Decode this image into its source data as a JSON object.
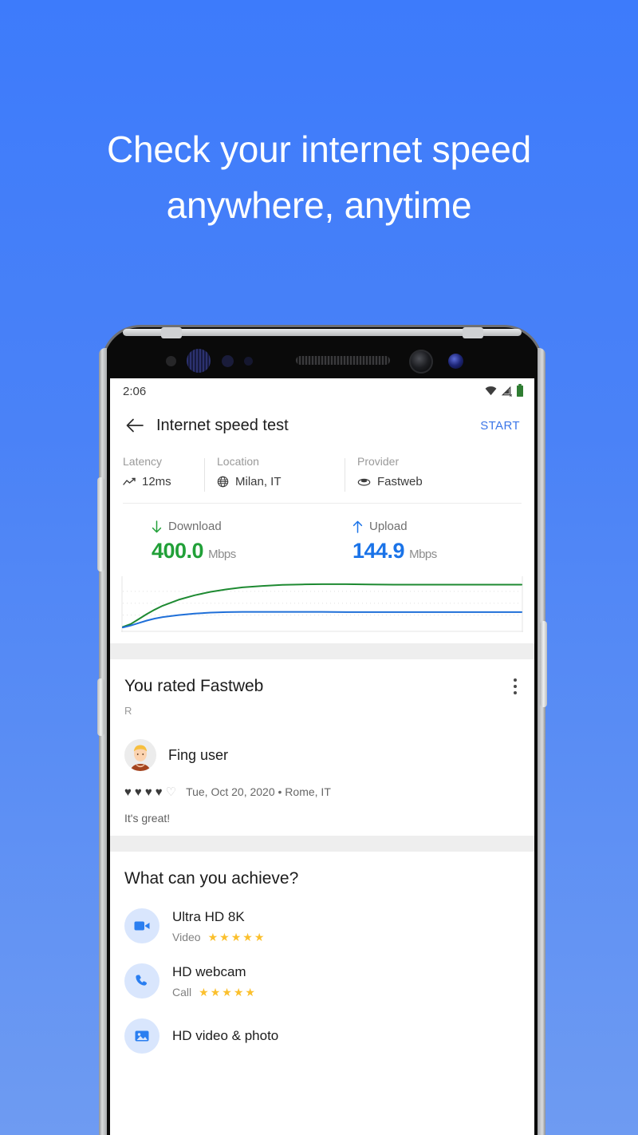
{
  "headline": {
    "line1": "Check your internet speed",
    "line2": "anywhere, anytime"
  },
  "statusbar": {
    "time": "2:06",
    "wifi_icon": "wifi-icon",
    "signal_icon": "signal-off-icon",
    "battery_icon": "battery-icon"
  },
  "appbar": {
    "back_icon": "back-arrow-icon",
    "title": "Internet speed test",
    "action": "START"
  },
  "info": [
    {
      "label": "Latency",
      "value": "12ms",
      "icon": "latency-graph-icon"
    },
    {
      "label": "Location",
      "value": "Milan, IT",
      "icon": "globe-icon"
    },
    {
      "label": "Provider",
      "value": "Fastweb",
      "icon": "router-icon"
    }
  ],
  "speeds": {
    "download": {
      "label": "Download",
      "value": "400.0",
      "unit": "Mbps",
      "color": "#21a038",
      "icon": "arrow-down-icon"
    },
    "upload": {
      "label": "Upload",
      "value": "144.9",
      "unit": "Mbps",
      "color": "#1a73e8",
      "icon": "arrow-up-icon"
    }
  },
  "chart_data": {
    "type": "line",
    "title": "",
    "xlabel": "",
    "ylabel": "",
    "xlim": [
      0,
      100
    ],
    "ylim": [
      0,
      100
    ],
    "grid": true,
    "legend_position": "none",
    "series": [
      {
        "name": "Download",
        "color": "#1e8a32",
        "x": [
          0,
          2,
          4,
          6,
          8,
          10,
          14,
          18,
          22,
          26,
          30,
          35,
          40,
          45,
          50,
          56,
          62,
          68,
          74,
          80,
          86,
          92,
          100
        ],
        "values": [
          4,
          10,
          20,
          30,
          39,
          47,
          59,
          68,
          75,
          80,
          84,
          87,
          89,
          90,
          90.5,
          90.5,
          90,
          89.5,
          89.5,
          89.5,
          89.5,
          89.5,
          89.5
        ]
      },
      {
        "name": "Upload",
        "color": "#1f6fd8",
        "x": [
          0,
          2,
          4,
          6,
          8,
          10,
          14,
          18,
          22,
          26,
          30,
          35,
          40,
          45,
          50,
          56,
          62,
          68,
          74,
          80,
          86,
          92,
          100
        ],
        "values": [
          3,
          7,
          12,
          17,
          21,
          24,
          28,
          31,
          33,
          34,
          34.5,
          34.5,
          34.5,
          34.5,
          34.5,
          34,
          34,
          34,
          34,
          34,
          34,
          34,
          34
        ]
      }
    ],
    "gridlines_y": [
      28,
      52,
      76
    ]
  },
  "review": {
    "title": "You rated Fastweb",
    "subtitle": "R",
    "menu_icon": "overflow-menu-icon",
    "user": "Fing user",
    "hearts_filled": 4,
    "hearts_total": 5,
    "meta": "Tue, Oct 20, 2020 • Rome, IT",
    "comment": "It's great!"
  },
  "achieve": {
    "title": "What can you achieve?",
    "items": [
      {
        "name": "Ultra HD 8K",
        "category": "Video",
        "stars": 5,
        "icon": "video-camera-icon"
      },
      {
        "name": "HD webcam",
        "category": "Call",
        "stars": 5,
        "icon": "phone-icon"
      },
      {
        "name": "HD video & photo",
        "category": "",
        "stars": 0,
        "icon": "image-icon"
      }
    ]
  }
}
